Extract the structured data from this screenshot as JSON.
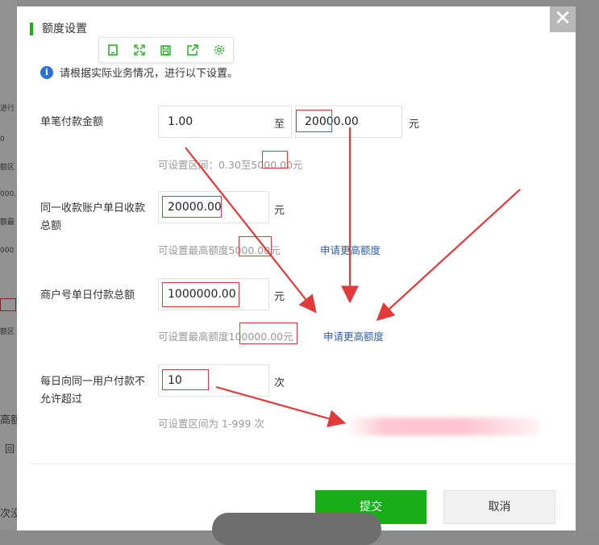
{
  "background_page": {
    "fragments": [
      "进行",
      "0",
      "额区",
      "000.",
      "额最",
      "000",
      "额区",
      "高额",
      "回",
      "次没"
    ]
  },
  "dialog": {
    "title": "额度设置",
    "close_glyph": "✕",
    "notice": "请根据实际业务情况，进行以下设置。",
    "info_glyph": "i",
    "toolbar_icons": [
      "tablet-icon",
      "expand-icon",
      "save-icon",
      "share-icon",
      "settings-icon"
    ],
    "rows": {
      "single": {
        "label": "单笔付款金额",
        "min_value": "1.00",
        "to": "至",
        "max_value": "20000.00",
        "unit": "元",
        "hint": "可设置区间：0.30至5000.00元"
      },
      "daily_same_account": {
        "label": "同一收款账户单日收款总额",
        "value": "20000.00",
        "unit": "元",
        "hint": "可设置最高额度5000.00元",
        "link": "申请更高额度"
      },
      "merchant_daily": {
        "label": "商户号单日付款总额",
        "value": "1000000.00",
        "unit": "元",
        "hint": "可设置最高额度100000.00元",
        "link": "申请更高额度"
      },
      "daily_same_user": {
        "label": "每日向同一用户付款不允许超过",
        "value": "10",
        "unit": "次",
        "hint": "可设置区间为 1-999 次"
      }
    },
    "buttons": {
      "submit": "提交",
      "cancel": "取消"
    }
  },
  "colors": {
    "accent": "#1aad19",
    "link": "#2f5fa8",
    "annotation": "#e23a3a",
    "info": "#2a6fd6"
  }
}
